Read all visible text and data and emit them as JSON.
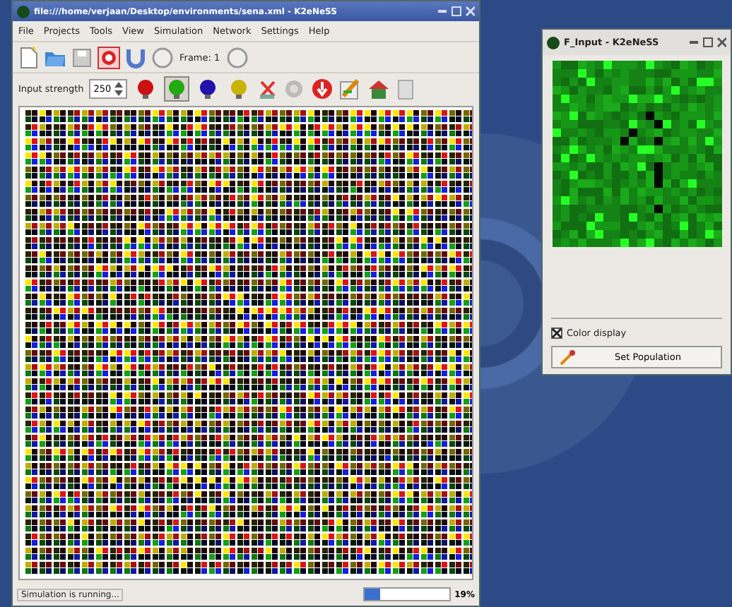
{
  "main_window": {
    "title": "file:///home/verjaan/Desktop/environments/sena.xml - K2eNeSS",
    "menu": [
      "File",
      "Projects",
      "Tools",
      "View",
      "Simulation",
      "Network",
      "Settings",
      "Help"
    ],
    "frame_label": "Frame: 1",
    "input_strength": {
      "label": "Input strength",
      "value": "250"
    },
    "brushes": [
      {
        "color": "#cc1111",
        "selected": false
      },
      {
        "color": "#22aa11",
        "selected": true
      },
      {
        "color": "#2211aa",
        "selected": false
      },
      {
        "color": "#c8b400",
        "selected": false
      }
    ],
    "status": {
      "message": "Simulation is running...",
      "level": 0.19,
      "reading": "19%"
    }
  },
  "input_window": {
    "title": "F_Input - K2eNeSS",
    "color_display": {
      "label": "Color display",
      "checked": true
    },
    "button": "Set Population"
  }
}
